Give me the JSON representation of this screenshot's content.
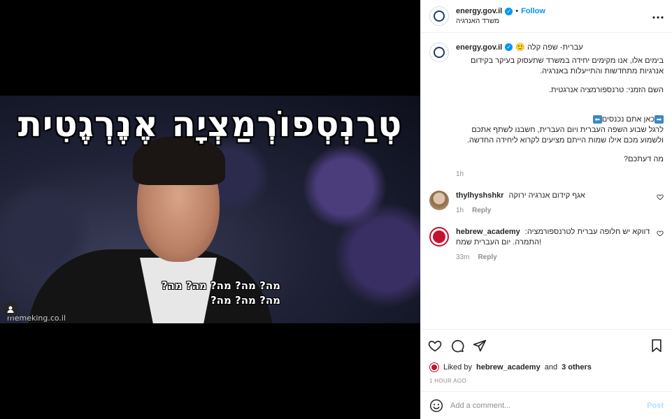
{
  "media": {
    "meme_title": "טְרַנְסְפוֹרְמַצְיָה אֶנֶרְגֶטִית",
    "meme_caption_line1": "מה? מה? מה? מה? מה?",
    "meme_caption_line2": "מה? מה? מה?",
    "watermark": "memeking.co.il",
    "tag_icon": "user-tag-icon"
  },
  "header": {
    "username": "energy.gov.il",
    "dot": "•",
    "follow_label": "Follow",
    "subtitle": "משרד האנרגיה",
    "more_icon": "more-options-icon"
  },
  "caption": {
    "username": "energy.gov.il",
    "title": "עברית- שפה קלה 🙂",
    "para1": "בימים אלו, אנו מקימים יחידה במשרד שתעסוק בעיקר בקידום אנרגיות מתחדשות והתייעלות באנרגיה.",
    "para2": "השם הזמני: טרנספורמציה אנרגטית.",
    "para3_prefix": "כאן אתם נכנסים",
    "para3": "לרגל שבוע השפה העברית ויום העברית, חשבנו לשתף אתכם ולשמוע מכם אילו שמות הייתם מציעים לקרוא ליחידה החדשה.",
    "para4": "מה דעתכם?",
    "time": "1h"
  },
  "comments": [
    {
      "username": "thylhyshshkr",
      "text": "אגף קידום אנרגיה ירוקה",
      "time": "1h",
      "reply": "Reply"
    },
    {
      "username": "hebrew_academy",
      "text": "דווקא יש חלופה עברית לטרנספורמציה: התמרה. יום העברית שמח!",
      "time": "33m",
      "reply": "Reply"
    }
  ],
  "likes": {
    "prefix": "Liked by",
    "user": "hebrew_academy",
    "and": "and",
    "others": "3 others"
  },
  "post_time": "1 HOUR AGO",
  "add_comment": {
    "placeholder": "Add a comment...",
    "post_label": "Post"
  },
  "colors": {
    "accent": "#0095f6",
    "verified": "#0095f6",
    "academy_red": "#c4122f"
  }
}
